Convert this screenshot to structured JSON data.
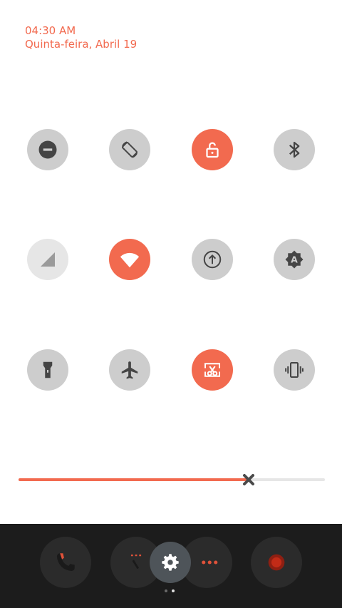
{
  "status": {
    "time": "04:30 AM",
    "date": "Quinta-feira, Abril 19"
  },
  "colors": {
    "accent": "#f26a4f",
    "tile_off": "#cdcdcd",
    "tile_dim": "#e6e6e6",
    "dock_bg": "#1c1c1c"
  },
  "tiles": [
    {
      "name": "do-not-disturb",
      "icon": "minus-circle-icon",
      "state": "off"
    },
    {
      "name": "auto-rotate",
      "icon": "rotate-icon",
      "state": "off"
    },
    {
      "name": "rotation-lock",
      "icon": "unlock-icon",
      "state": "on"
    },
    {
      "name": "bluetooth",
      "icon": "bluetooth-icon",
      "state": "off"
    },
    {
      "name": "mobile-data",
      "icon": "signal-icon",
      "state": "disabled"
    },
    {
      "name": "wifi",
      "icon": "wifi-icon",
      "state": "on"
    },
    {
      "name": "data-sync",
      "icon": "upload-circle-icon",
      "state": "off"
    },
    {
      "name": "auto-brightness",
      "icon": "brightness-auto-icon",
      "state": "off"
    },
    {
      "name": "flashlight",
      "icon": "flashlight-icon",
      "state": "off"
    },
    {
      "name": "airplane-mode",
      "icon": "airplane-icon",
      "state": "off"
    },
    {
      "name": "screenshot",
      "icon": "scissors-icon",
      "state": "on"
    },
    {
      "name": "vibrate",
      "icon": "vibrate-icon",
      "state": "off"
    }
  ],
  "brightness": {
    "level": 0.75
  },
  "dock": {
    "apps": [
      {
        "name": "phone",
        "icon": "phone-icon"
      },
      {
        "name": "contacts",
        "icon": "contacts-icon"
      },
      {
        "name": "messages",
        "icon": "messages-icon"
      },
      {
        "name": "camera",
        "icon": "camera-icon"
      }
    ],
    "settings_icon": "gear-icon",
    "page_count": 2,
    "active_page": 1
  }
}
